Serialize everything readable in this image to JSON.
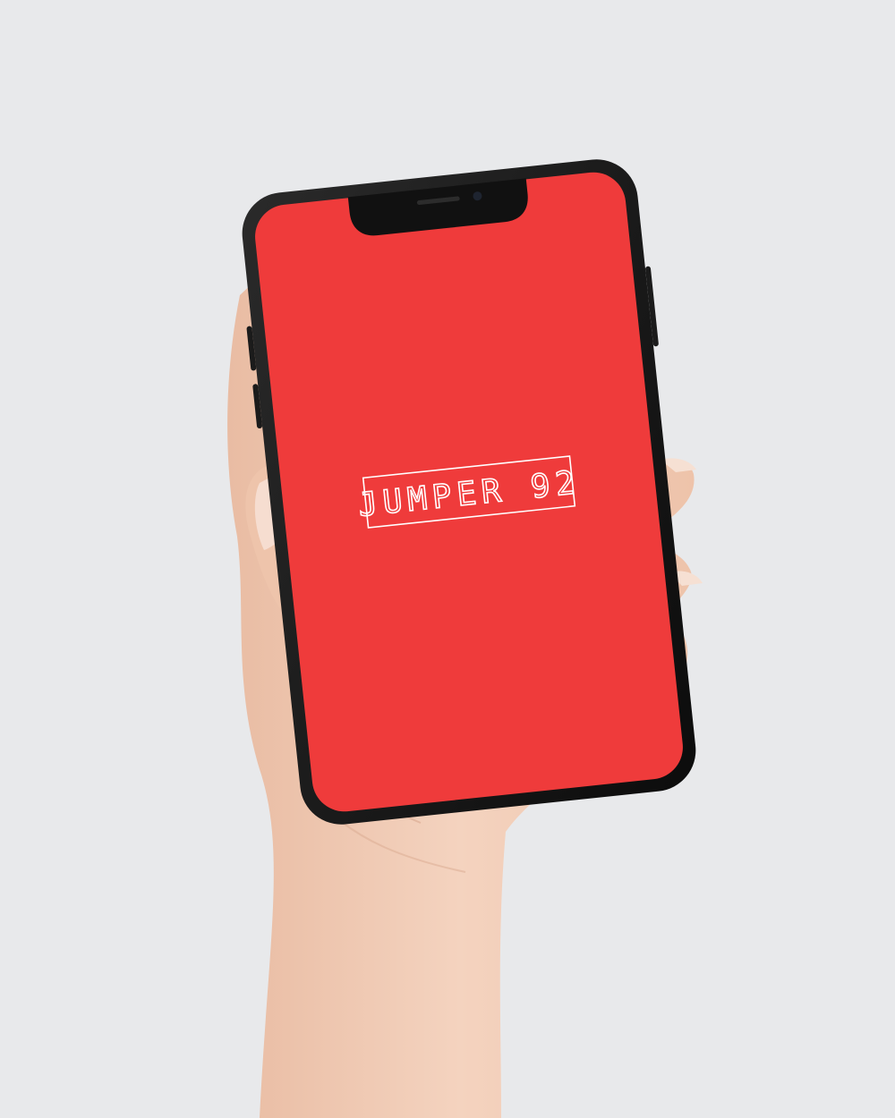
{
  "screen": {
    "background_color": "#ef3b3b",
    "logo": {
      "text": "JUMPER 92",
      "color": "#ffffff"
    }
  },
  "colors": {
    "backdrop": "#e8e9eb",
    "phone_frame": "#111111",
    "skin": "#f1cdb6"
  }
}
